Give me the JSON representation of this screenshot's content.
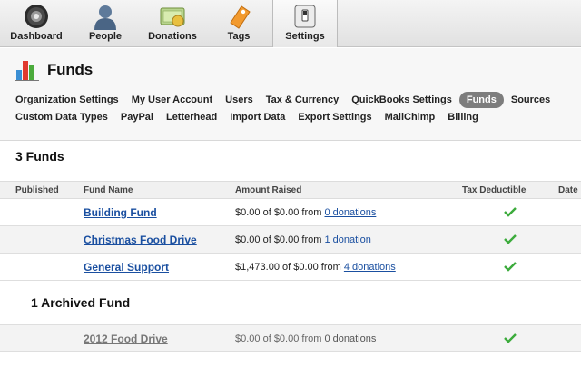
{
  "nav": {
    "items": [
      {
        "label": "Dashboard",
        "icon": "dashboard-gauge-icon"
      },
      {
        "label": "People",
        "icon": "person-icon"
      },
      {
        "label": "Donations",
        "icon": "money-icon"
      },
      {
        "label": "Tags",
        "icon": "tag-icon"
      },
      {
        "label": "Settings",
        "icon": "switch-icon",
        "active": true
      }
    ]
  },
  "header": {
    "title": "Funds",
    "subnav_row1": [
      "Organization Settings",
      "My User Account",
      "Users",
      "Tax & Currency",
      "QuickBooks Settings",
      "Funds",
      "Sources"
    ],
    "subnav_row2": [
      "Custom Data Types",
      "PayPal",
      "Letterhead",
      "Import Data",
      "Export Settings",
      "MailChimp",
      "Billing"
    ],
    "active_subnav": "Funds"
  },
  "funds": {
    "count_title": "3 Funds",
    "columns": [
      "Published",
      "Fund Name",
      "Amount Raised",
      "Tax Deductible",
      "Date"
    ],
    "rows": [
      {
        "name": "Building Fund",
        "amount": "$0.00 of $0.00 from",
        "donations": "0 donations",
        "tax_deductible": true
      },
      {
        "name": "Christmas Food Drive",
        "amount": "$0.00 of $0.00 from",
        "donations": "1 donation",
        "tax_deductible": true
      },
      {
        "name": "General Support",
        "amount": "$1,473.00 of $0.00 from",
        "donations": "4 donations",
        "tax_deductible": true
      }
    ]
  },
  "archived": {
    "count_title": "1 Archived Fund",
    "rows": [
      {
        "name": "2012 Food Drive",
        "amount": "$0.00 of $0.00 from",
        "donations": "0 donations",
        "tax_deductible": true
      }
    ]
  },
  "colors": {
    "link": "#1a4fa0",
    "check": "#3cab3c",
    "active_pill": "#7d7d7d"
  }
}
